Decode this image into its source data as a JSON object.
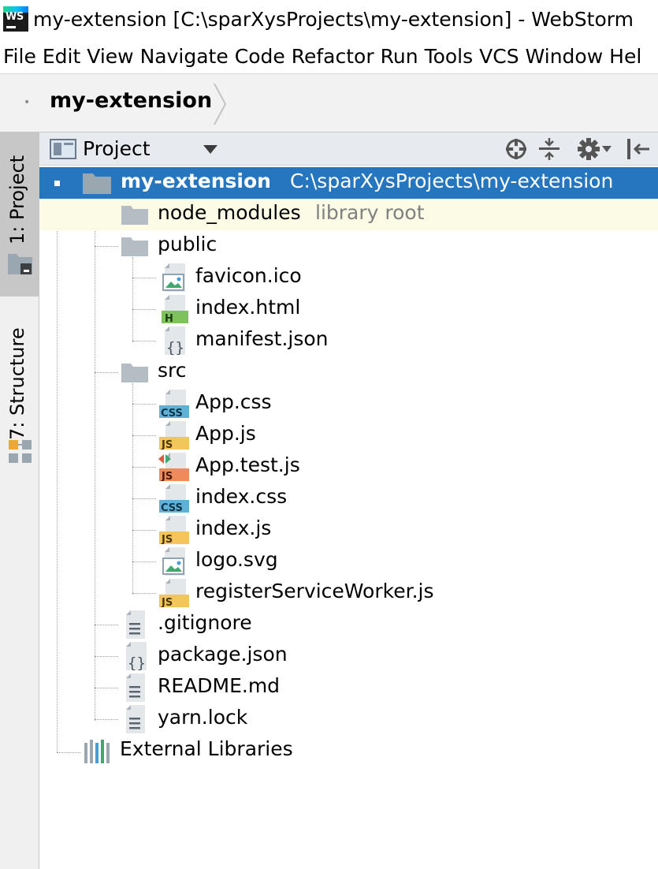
{
  "window": {
    "title": "my-extension [C:\\sparXysProjects\\my-extension] - WebStorm"
  },
  "menu": [
    "File",
    "Edit",
    "View",
    "Navigate",
    "Code",
    "Refactor",
    "Run",
    "Tools",
    "VCS",
    "Window",
    "Hel"
  ],
  "navbar": {
    "breadcrumb": "my-extension"
  },
  "side_tabs": {
    "project": "1: Project",
    "structure": "7: Structure"
  },
  "panel": {
    "title": "Project"
  },
  "tree": {
    "root": {
      "name": "my-extension",
      "path": "C:\\sparXysProjects\\my-extension"
    },
    "node_modules": {
      "name": "node_modules",
      "hint": "library root"
    },
    "public": {
      "name": "public",
      "children": [
        "favicon.ico",
        "index.html",
        "manifest.json"
      ]
    },
    "src": {
      "name": "src",
      "children": [
        "App.css",
        "App.js",
        "App.test.js",
        "index.css",
        "index.js",
        "logo.svg",
        "registerServiceWorker.js"
      ]
    },
    "root_files": [
      ".gitignore",
      "package.json",
      "README.md",
      "yarn.lock"
    ],
    "external": "External Libraries"
  },
  "colors": {
    "selection": "#2675bf",
    "library_root_bg": "#fcfbe6",
    "folder": "#b4bcc4",
    "css_badge": "#5fb2d6",
    "js_badge": "#f4c55a",
    "test_js_badge": "#ef8a5b",
    "html_badge": "#7fc15b"
  }
}
